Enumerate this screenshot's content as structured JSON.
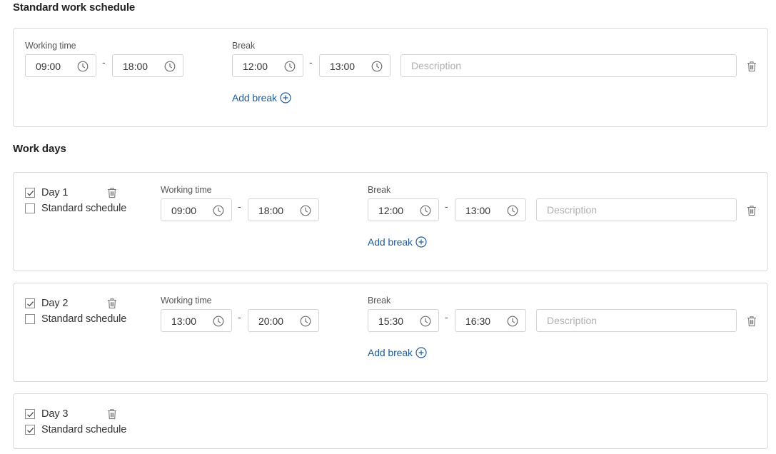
{
  "standard": {
    "title": "Standard work schedule",
    "working_time_label": "Working time",
    "break_label": "Break",
    "work_start": "09:00",
    "work_end": "18:00",
    "break_start": "12:00",
    "break_end": "13:00",
    "description_placeholder": "Description",
    "add_break_label": "Add break"
  },
  "workdays": {
    "title": "Work days",
    "days": [
      {
        "name": "Day 1",
        "checked": true,
        "standard_schedule_label": "Standard schedule",
        "standard_schedule_checked": false,
        "working_time_label": "Working time",
        "break_label": "Break",
        "work_start": "09:00",
        "work_end": "18:00",
        "break_start": "12:00",
        "break_end": "13:00",
        "description_placeholder": "Description",
        "add_break_label": "Add break"
      },
      {
        "name": "Day 2",
        "checked": true,
        "standard_schedule_label": "Standard schedule",
        "standard_schedule_checked": false,
        "working_time_label": "Working time",
        "break_label": "Break",
        "work_start": "13:00",
        "work_end": "20:00",
        "break_start": "15:30",
        "break_end": "16:30",
        "description_placeholder": "Description",
        "add_break_label": "Add break"
      },
      {
        "name": "Day 3",
        "checked": true,
        "standard_schedule_label": "Standard schedule",
        "standard_schedule_checked": true
      }
    ]
  },
  "separator": "-",
  "icons": {
    "clock": "clock-icon",
    "trash": "trash-icon",
    "add": "plus-circle-icon",
    "check": "checkmark-icon"
  },
  "colors": {
    "link": "#1f5c99",
    "border": "#d9d9d9",
    "placeholder": "#b0b0b0"
  }
}
